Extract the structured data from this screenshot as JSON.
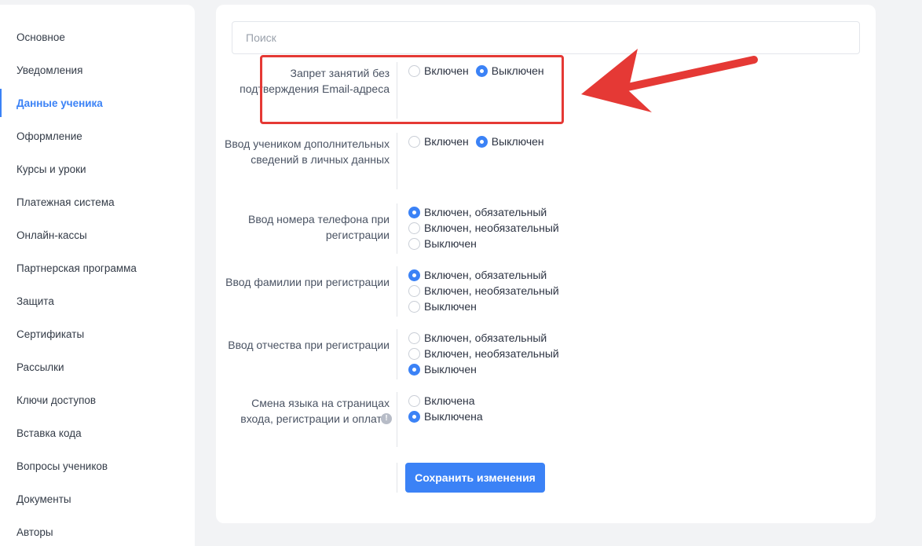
{
  "sidebar": {
    "items": [
      {
        "label": "Основное",
        "active": false
      },
      {
        "label": "Уведомления",
        "active": false
      },
      {
        "label": "Данные ученика",
        "active": true
      },
      {
        "label": "Оформление",
        "active": false
      },
      {
        "label": "Курсы и уроки",
        "active": false
      },
      {
        "label": "Платежная система",
        "active": false
      },
      {
        "label": "Онлайн-кассы",
        "active": false
      },
      {
        "label": "Партнерская программа",
        "active": false
      },
      {
        "label": "Защита",
        "active": false
      },
      {
        "label": "Сертификаты",
        "active": false
      },
      {
        "label": "Рассылки",
        "active": false
      },
      {
        "label": "Ключи доступов",
        "active": false
      },
      {
        "label": "Вставка кода",
        "active": false
      },
      {
        "label": "Вопросы учеников",
        "active": false
      },
      {
        "label": "Документы",
        "active": false
      },
      {
        "label": "Авторы",
        "active": false
      }
    ]
  },
  "search": {
    "placeholder": "Поиск",
    "value": ""
  },
  "settings": [
    {
      "label": "Запрет занятий без подтверждения Email-адреса",
      "options": [
        {
          "label": "Включен",
          "checked": false
        },
        {
          "label": "Выключен",
          "checked": true
        }
      ]
    },
    {
      "label": "Ввод учеником дополнительных сведений в личных данных",
      "options": [
        {
          "label": "Включен",
          "checked": false
        },
        {
          "label": "Выключен",
          "checked": true
        }
      ]
    },
    {
      "label": "Ввод номера телефона при регистрации",
      "options": [
        {
          "label": "Включен, обязательный",
          "checked": true
        },
        {
          "label": "Включен, необязательный",
          "checked": false
        },
        {
          "label": "Выключен",
          "checked": false
        }
      ]
    },
    {
      "label": "Ввод фамилии при регистрации",
      "options": [
        {
          "label": "Включен, обязательный",
          "checked": true
        },
        {
          "label": "Включен, необязательный",
          "checked": false
        },
        {
          "label": "Выключен",
          "checked": false
        }
      ]
    },
    {
      "label": "Ввод отчества при регистрации",
      "options": [
        {
          "label": "Включен, обязательный",
          "checked": false
        },
        {
          "label": "Включен, необязательный",
          "checked": false
        },
        {
          "label": "Выключен",
          "checked": true
        }
      ]
    },
    {
      "label": "Смена языка на страницах входа, регистрации и оплаты",
      "info_icon": "info-icon",
      "options": [
        {
          "label": "Включена",
          "checked": false
        },
        {
          "label": "Выключена",
          "checked": true
        }
      ]
    }
  ],
  "save_button": {
    "label": "Сохранить изменения"
  },
  "colors": {
    "accent": "#3b82f6",
    "annotation": "#e53935"
  }
}
